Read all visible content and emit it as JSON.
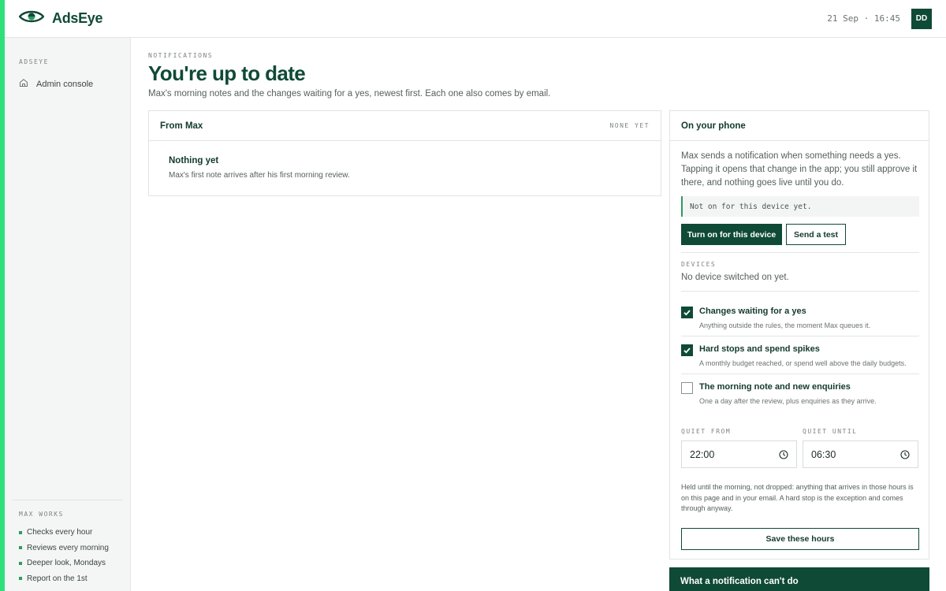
{
  "brand": {
    "name": "AdsEye"
  },
  "topbar": {
    "datetime": "21 Sep · 16:45",
    "avatar_initials": "DD"
  },
  "sidebar": {
    "section_label": "ADSEYE",
    "items": [
      {
        "label": "Admin console",
        "icon": "home-icon"
      }
    ],
    "max_works": {
      "label": "MAX WORKS",
      "items": [
        "Checks every hour",
        "Reviews every morning",
        "Deeper look, Mondays",
        "Report on the 1st"
      ]
    }
  },
  "main": {
    "eyebrow": "NOTIFICATIONS",
    "title": "You're up to date",
    "subtitle": "Max's morning notes and the changes waiting for a yes, newest first. Each one also comes by email."
  },
  "from_max": {
    "title": "From Max",
    "tag": "NONE YET",
    "empty_title": "Nothing yet",
    "empty_text": "Max's first note arrives after his first morning review."
  },
  "phone": {
    "title": "On your phone",
    "intro": "Max sends a notification when something needs a yes. Tapping it opens that change in the app; you still approve it there, and nothing goes live until you do.",
    "status": "Not on for this device yet.",
    "turn_on_label": "Turn on for this device",
    "send_test_label": "Send a test",
    "devices_label": "DEVICES",
    "devices_value": "No device switched on yet.",
    "prefs": [
      {
        "title": "Changes waiting for a yes",
        "desc": "Anything outside the rules, the moment Max queues it.",
        "checked": true
      },
      {
        "title": "Hard stops and spend spikes",
        "desc": "A monthly budget reached, or spend well above the daily budgets.",
        "checked": true
      },
      {
        "title": "The morning note and new enquiries",
        "desc": "One a day after the review, plus enquiries as they arrive.",
        "checked": false
      }
    ],
    "quiet_from_label": "QUIET FROM",
    "quiet_from_value": "22:00",
    "quiet_until_label": "QUIET UNTIL",
    "quiet_until_value": "06:30",
    "quiet_note": "Held until the morning, not dropped: anything that arrives in those hours is on this page and in your email. A hard stop is the exception and comes through anyway.",
    "save_label": "Save these hours"
  },
  "cant_do": {
    "title": "What a notification can't do"
  },
  "colors": {
    "brand": "#0f4a37",
    "accent_strip": "#2ee07a",
    "bullet": "#2e9a63"
  }
}
